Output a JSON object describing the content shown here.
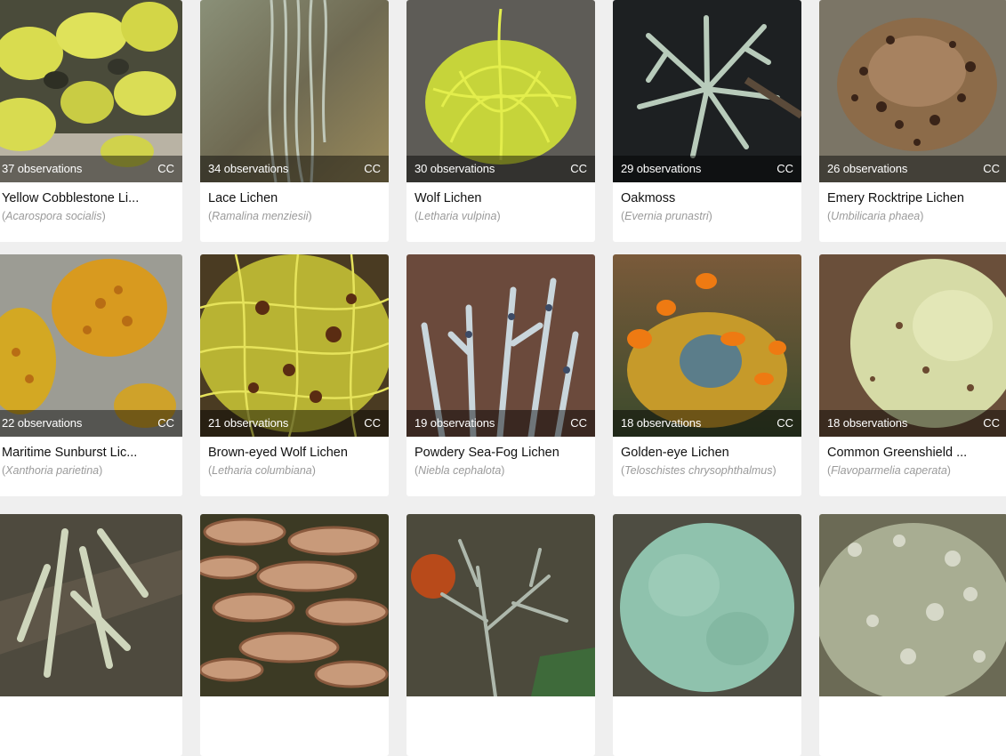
{
  "cards": [
    {
      "obs": "37 observations",
      "license": "CC",
      "name": "Yellow Cobblestone Li...",
      "scientific": "Acarospora socialis"
    },
    {
      "obs": "34 observations",
      "license": "CC",
      "name": "Lace Lichen",
      "scientific": "Ramalina menziesii"
    },
    {
      "obs": "30 observations",
      "license": "CC",
      "name": "Wolf Lichen",
      "scientific": "Letharia vulpina"
    },
    {
      "obs": "29 observations",
      "license": "CC",
      "name": "Oakmoss",
      "scientific": "Evernia prunastri"
    },
    {
      "obs": "26 observations",
      "license": "CC",
      "name": "Emery Rocktripe Lichen",
      "scientific": "Umbilicaria phaea"
    },
    {
      "obs": "22 observations",
      "license": "CC",
      "name": "Maritime Sunburst Lic...",
      "scientific": "Xanthoria parietina"
    },
    {
      "obs": "21 observations",
      "license": "CC",
      "name": "Brown-eyed Wolf Lichen",
      "scientific": "Letharia columbiana"
    },
    {
      "obs": "19 observations",
      "license": "CC",
      "name": "Powdery Sea-Fog Lichen",
      "scientific": "Niebla cephalota"
    },
    {
      "obs": "18 observations",
      "license": "CC",
      "name": "Golden-eye Lichen",
      "scientific": "Teloschistes chrysophthalmus"
    },
    {
      "obs": "18 observations",
      "license": "CC",
      "name": "Common Greenshield ...",
      "scientific": "Flavoparmelia caperata"
    }
  ]
}
